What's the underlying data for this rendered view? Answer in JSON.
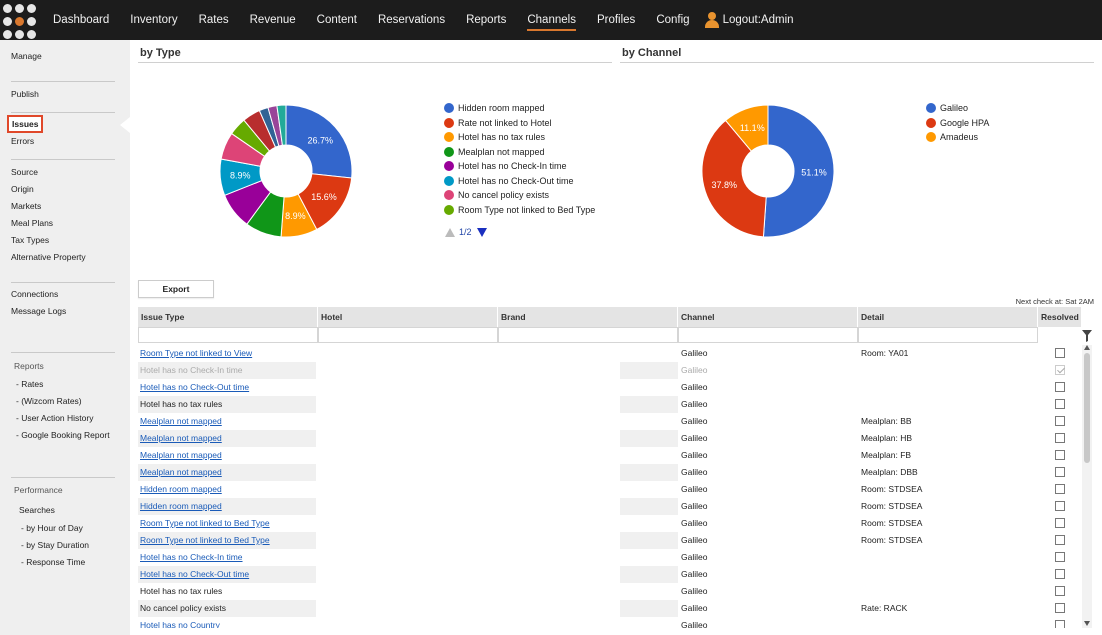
{
  "nav": {
    "items": [
      {
        "label": "Dashboard",
        "active": false
      },
      {
        "label": "Inventory",
        "active": false
      },
      {
        "label": "Rates",
        "active": false
      },
      {
        "label": "Revenue",
        "active": false
      },
      {
        "label": "Content",
        "active": false
      },
      {
        "label": "Reservations",
        "active": false
      },
      {
        "label": "Reports",
        "active": false
      },
      {
        "label": "Channels",
        "active": true
      },
      {
        "label": "Profiles",
        "active": false
      },
      {
        "label": "Config",
        "active": false
      }
    ],
    "logout_label": "Logout:Admin",
    "accent_color": "#d9782e"
  },
  "sidebar": {
    "manage": "Manage",
    "publish": "Publish",
    "issues": "Issues",
    "errors": "Errors",
    "group1": [
      "Source",
      "Origin",
      "Markets",
      "Meal Plans",
      "Tax Types",
      "Alternative Property"
    ],
    "connections": "Connections",
    "message_logs": "Message Logs",
    "reports_head": "Reports",
    "reports": [
      "- Rates",
      "- (Wizcom Rates)",
      "- User Action History",
      "- Google Booking Report"
    ],
    "performance_head": "Performance",
    "searches": "Searches",
    "performance": [
      "- by Hour of Day",
      "- by Stay Duration",
      "- Response Time"
    ]
  },
  "by_type": {
    "title": "by Type",
    "legend": [
      {
        "label": "Hidden room mapped",
        "color": "#3366cc"
      },
      {
        "label": "Rate not linked to Hotel",
        "color": "#dc3912"
      },
      {
        "label": "Hotel has no tax rules",
        "color": "#ff9900"
      },
      {
        "label": "Mealplan not mapped",
        "color": "#109618"
      },
      {
        "label": "Hotel has no Check-In time",
        "color": "#990099"
      },
      {
        "label": "Hotel has no Check-Out time",
        "color": "#0099c6"
      },
      {
        "label": "No cancel policy exists",
        "color": "#dd4477"
      },
      {
        "label": "Room Type not linked to Bed Type",
        "color": "#66aa00"
      }
    ],
    "pager": "1/2"
  },
  "by_channel": {
    "title": "by Channel",
    "legend": [
      {
        "label": "Galileo",
        "color": "#3366cc"
      },
      {
        "label": "Google HPA",
        "color": "#dc3912"
      },
      {
        "label": "Amadeus",
        "color": "#ff9900"
      }
    ]
  },
  "chart_data": [
    {
      "type": "pie",
      "title": "by Type",
      "categories": [
        "Hidden room mapped",
        "Rate not linked to Hotel",
        "Hotel has no tax rules",
        "Mealplan not mapped",
        "Hotel has no Check-In time",
        "Hotel has no Check-Out time",
        "No cancel policy exists",
        "Room Type not linked to Bed Type",
        "",
        "",
        "",
        "",
        ""
      ],
      "values": [
        26.7,
        15.6,
        8.9,
        8.9,
        8.9,
        8.9,
        6.7,
        4.4,
        4.4,
        2.2,
        2.2,
        2.2,
        0
      ],
      "colors": [
        "#3366cc",
        "#dc3912",
        "#ff9900",
        "#109618",
        "#990099",
        "#0099c6",
        "#dd4477",
        "#66aa00",
        "#b82e2e",
        "#316395",
        "#994499",
        "#22aa99",
        "#aaaa11"
      ],
      "labels": [
        "26.7%",
        "15.6%",
        "8.9%",
        "",
        "",
        "8.9%",
        "",
        "",
        "",
        "",
        "",
        "",
        ""
      ]
    },
    {
      "type": "pie",
      "title": "by Channel",
      "categories": [
        "Galileo",
        "Google HPA",
        "Amadeus"
      ],
      "values": [
        51.1,
        37.8,
        11.1
      ],
      "colors": [
        "#3366cc",
        "#dc3912",
        "#ff9900"
      ],
      "labels": [
        "51.1%",
        "37.8%",
        "11.1%"
      ]
    }
  ],
  "actions": {
    "export_label": "Export",
    "next_check": "Next check at: Sat 2AM"
  },
  "table": {
    "columns": [
      "Issue Type",
      "Hotel",
      "Brand",
      "Channel",
      "Detail",
      "Resolved"
    ],
    "rows": [
      {
        "issue": "Room Type not linked to View",
        "link": true,
        "dim": false,
        "channel": "Galileo",
        "detail": "Room: YA01",
        "resolved": false
      },
      {
        "issue": "Hotel has no Check-In time",
        "link": false,
        "dim": true,
        "channel": "Galileo",
        "detail": "",
        "resolved": true
      },
      {
        "issue": "Hotel has no Check-Out time",
        "link": true,
        "dim": false,
        "channel": "Galileo",
        "detail": "",
        "resolved": false
      },
      {
        "issue": "Hotel has no tax rules",
        "link": false,
        "dim": false,
        "channel": "Galileo",
        "detail": "",
        "resolved": false
      },
      {
        "issue": "Mealplan not mapped",
        "link": true,
        "dim": false,
        "channel": "Galileo",
        "detail": "Mealplan: BB",
        "resolved": false
      },
      {
        "issue": "Mealplan not mapped",
        "link": true,
        "dim": false,
        "channel": "Galileo",
        "detail": "Mealplan: HB",
        "resolved": false
      },
      {
        "issue": "Mealplan not mapped",
        "link": true,
        "dim": false,
        "channel": "Galileo",
        "detail": "Mealplan: FB",
        "resolved": false
      },
      {
        "issue": "Mealplan not mapped",
        "link": true,
        "dim": false,
        "channel": "Galileo",
        "detail": "Mealplan: DBB",
        "resolved": false
      },
      {
        "issue": "Hidden room mapped",
        "link": true,
        "dim": false,
        "channel": "Galileo",
        "detail": "Room: STDSEA",
        "resolved": false
      },
      {
        "issue": "Hidden room mapped",
        "link": true,
        "dim": false,
        "channel": "Galileo",
        "detail": "Room: STDSEA",
        "resolved": false
      },
      {
        "issue": "Room Type not linked to Bed Type",
        "link": true,
        "dim": false,
        "channel": "Galileo",
        "detail": "Room: STDSEA",
        "resolved": false
      },
      {
        "issue": "Room Type not linked to Bed Type",
        "link": true,
        "dim": false,
        "channel": "Galileo",
        "detail": "Room: STDSEA",
        "resolved": false
      },
      {
        "issue": "Hotel has no Check-In time",
        "link": true,
        "dim": false,
        "channel": "Galileo",
        "detail": "",
        "resolved": false
      },
      {
        "issue": "Hotel has no Check-Out time",
        "link": true,
        "dim": false,
        "channel": "Galileo",
        "detail": "",
        "resolved": false
      },
      {
        "issue": "Hotel has no tax rules",
        "link": false,
        "dim": false,
        "channel": "Galileo",
        "detail": "",
        "resolved": false
      },
      {
        "issue": "No cancel policy exists",
        "link": false,
        "dim": false,
        "channel": "Galileo",
        "detail": "Rate: RACK",
        "resolved": false
      },
      {
        "issue": "Hotel has no Country",
        "link": true,
        "dim": false,
        "channel": "Galileo",
        "detail": "",
        "resolved": false
      }
    ]
  }
}
